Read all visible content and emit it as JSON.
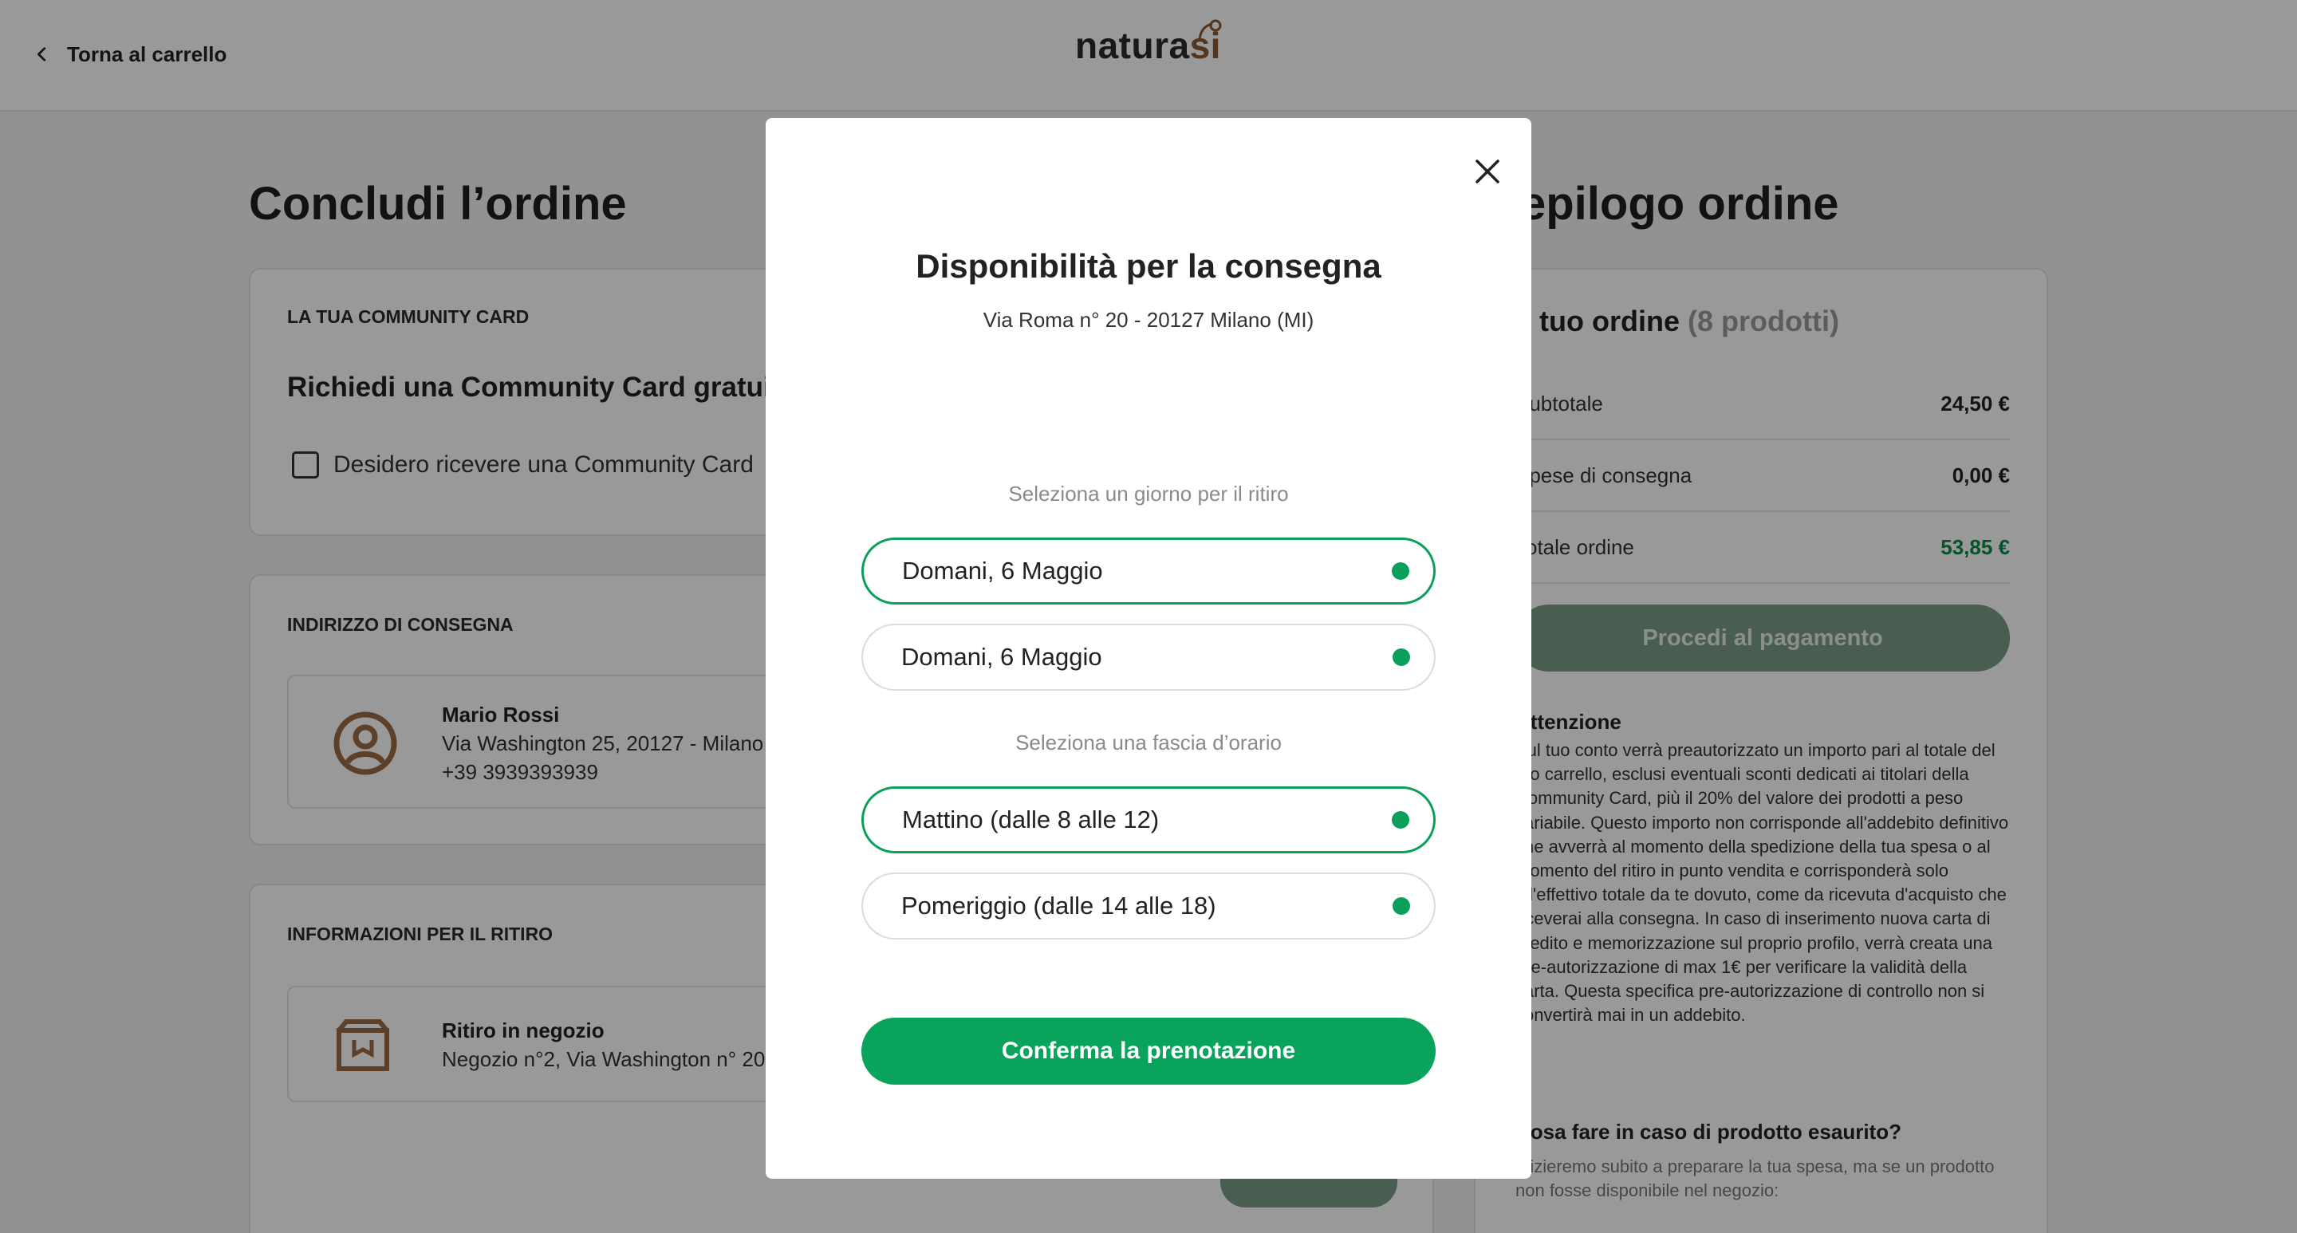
{
  "header": {
    "back_label": "Torna al carrello",
    "logo_main": "natura",
    "logo_accent": "si"
  },
  "left": {
    "title": "Concludi l’ordine",
    "community": {
      "label": "LA TUA COMMUNITY CARD",
      "title": "Richiedi una Community Card gratuita",
      "checkbox_label": "Desidero ricevere una Community Card"
    },
    "address": {
      "label": "INDIRIZZO DI CONSEGNA",
      "name": "Mario Rossi",
      "street": "Via Washington 25, 20127 - Milano",
      "phone": "+39 3939393939"
    },
    "pickup": {
      "label": "INFORMAZIONI PER IL RITIRO",
      "title": "Ritiro in negozio",
      "store": "Negozio n°2, Via Washington n° 20"
    }
  },
  "right": {
    "title": "Riepilogo ordine",
    "order_heading": "Il tuo ordine",
    "order_count": "(8 prodotti)",
    "rows": [
      {
        "label": "Subtotale",
        "value": "24,50 €"
      },
      {
        "label": "Spese di consegna",
        "value": "0,00 €"
      },
      {
        "label": "Totale ordine",
        "value": "53,85 €"
      }
    ],
    "pay_label": "Procedi al pagamento",
    "attention_title": "Attenzione",
    "attention_text": "Sul tuo conto verrà preautorizzato un importo pari al totale del tuo carrello, esclusi eventuali sconti dedicati ai titolari della Community Card, più il 20% del valore dei prodotti a peso variabile. Questo importo non corrisponde all'addebito definitivo che avverrà al momento della spedizione della tua spesa o al momento del ritiro in punto vendita e corrisponderà solo all'effettivo totale da te dovuto, come da ricevuta d'acquisto che riceverai alla consegna. In caso di inserimento nuova carta di credito e memorizzazione sul proprio profilo, verrà creata una pre-autorizzazione di max 1€ per verificare la validità della carta. Questa specifica pre-autorizzazione di controllo non si convertirà mai in un addebito.",
    "faq_title": "Cosa fare in caso di prodotto esaurito?",
    "faq_text": "Inizieremo subito a preparare la tua spesa, ma se un prodotto non fosse disponibile nel negozio:"
  },
  "modal": {
    "title": "Disponibilità per la consegna",
    "subtitle": "Via Roma n° 20 - 20127 Milano (MI)",
    "day_label": "Seleziona un giorno per il ritiro",
    "days": [
      "Domani, 6 Maggio",
      "Domani, 6 Maggio"
    ],
    "slot_label": "Seleziona una fascia d’orario",
    "slots": [
      "Mattino (dalle 8 alle 12)",
      "Pomeriggio (dalle 14 alle 18)"
    ],
    "confirm_label": "Conferma la prenotazione"
  },
  "colors": {
    "brand_green": "#0aa35b",
    "logo_brown": "#8b5a34",
    "disabled_button": "#7a9b86",
    "overlay": "rgba(0,0,0,0.40)"
  },
  "icons": [
    "chevron-left-icon",
    "user-circle-icon",
    "store-box-icon",
    "close-icon"
  ]
}
